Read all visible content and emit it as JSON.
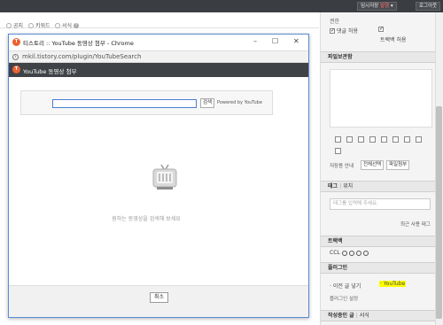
{
  "topbar": {
    "temp_save_label": "임시저장",
    "publish_label": "발행",
    "logout_label": "로그아웃"
  },
  "editor_options": {
    "radios": [
      {
        "label": "공지"
      },
      {
        "label": "키워드"
      },
      {
        "label": "서식"
      }
    ]
  },
  "popup": {
    "title": "티스토리 :: YouTube 동영상 첨부 - Chrome",
    "url": "mkil.tistory.com/plugin/YouTubeSearch",
    "header": "YouTube 동영상 첨부",
    "search_button": "검색",
    "powered_by": "Powered by YouTube",
    "empty_text": "원하는 동영상을 검색해 보세요",
    "cancel_label": "취소"
  },
  "sidebar": {
    "permission_label": "권한",
    "allow_comment": "댓글 허용",
    "allow_trackback": "트랙백 허용",
    "file_storage_title": "파일보관함",
    "storage_info": "저장용 안내",
    "select_all": "전체선택",
    "attach_file": "파일첨부",
    "tag_title": "태그",
    "location_title": "위치",
    "tag_placeholder": "태그를 입력해 주세요.",
    "recent_tags": "최근 사용 태그",
    "trackback_title": "트랙백",
    "ccl_label": "CCL",
    "plugin_title": "플러그인",
    "prev_post_label": "이전 글 넣기",
    "youtube_label": "YouTube",
    "plugin_settings": "플러그인 설정",
    "writing_title": "작성중인 글",
    "format_title": "서식"
  },
  "colors": {
    "accent_orange": "#ea6232",
    "highlight_yellow": "#ffff00",
    "dark_header": "#3f4347"
  }
}
